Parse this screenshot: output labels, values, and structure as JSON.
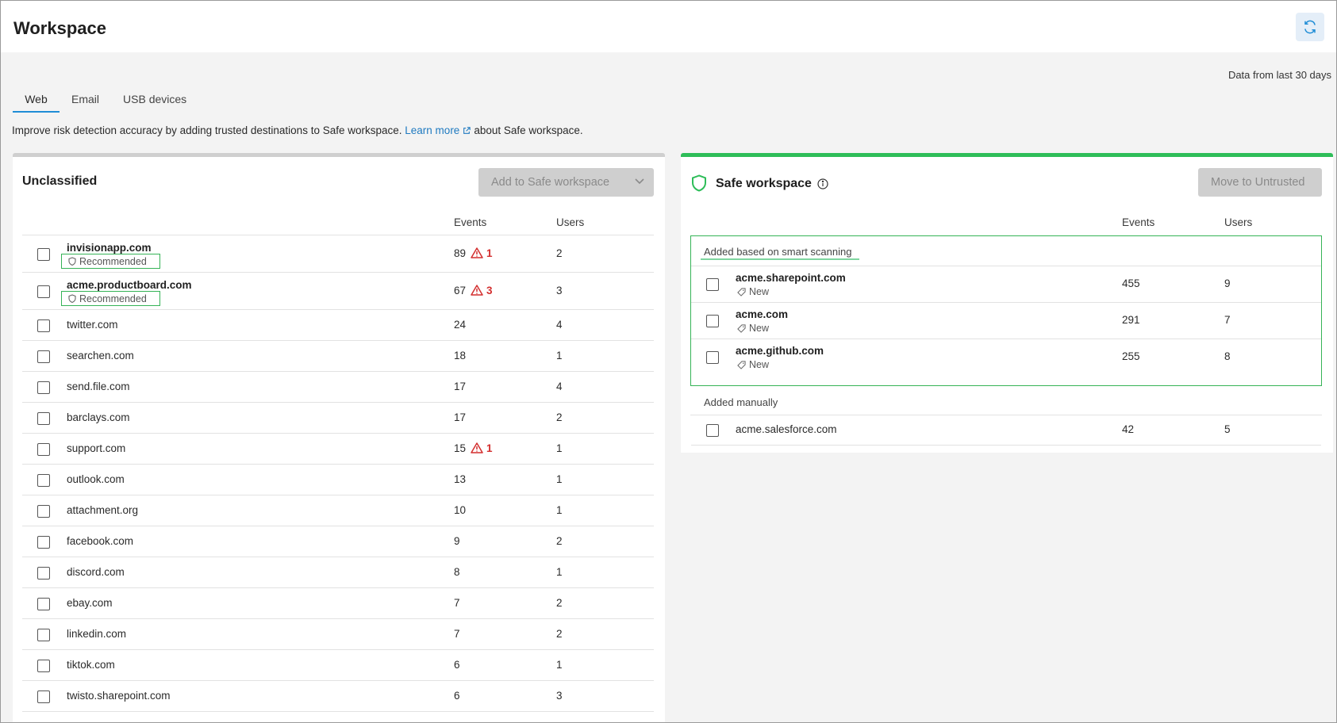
{
  "header": {
    "title": "Workspace"
  },
  "data_range": "Data from last 30 days",
  "tabs": [
    {
      "label": "Web",
      "active": true
    },
    {
      "label": "Email",
      "active": false
    },
    {
      "label": "USB devices",
      "active": false
    }
  ],
  "intro": {
    "before": "Improve risk detection accuracy by adding trusted destinations to Safe workspace.",
    "link": "Learn more",
    "after": "about Safe workspace."
  },
  "unclassified": {
    "title": "Unclassified",
    "button": "Add to Safe workspace",
    "columns": {
      "events": "Events",
      "users": "Users"
    },
    "recommended_label": "Recommended",
    "rows": [
      {
        "domain": "invisionapp.com",
        "events": "89",
        "alerts": "1",
        "users": "2",
        "recommended": true
      },
      {
        "domain": "acme.productboard.com",
        "events": "67",
        "alerts": "3",
        "users": "3",
        "recommended": true
      },
      {
        "domain": "twitter.com",
        "events": "24",
        "alerts": "",
        "users": "4"
      },
      {
        "domain": "searchen.com",
        "events": "18",
        "alerts": "",
        "users": "1"
      },
      {
        "domain": "send.file.com",
        "events": "17",
        "alerts": "",
        "users": "4"
      },
      {
        "domain": "barclays.com",
        "events": "17",
        "alerts": "",
        "users": "2"
      },
      {
        "domain": "support.com",
        "events": "15",
        "alerts": "1",
        "users": "1"
      },
      {
        "domain": "outlook.com",
        "events": "13",
        "alerts": "",
        "users": "1"
      },
      {
        "domain": "attachment.org",
        "events": "10",
        "alerts": "",
        "users": "1"
      },
      {
        "domain": "facebook.com",
        "events": "9",
        "alerts": "",
        "users": "2"
      },
      {
        "domain": "discord.com",
        "events": "8",
        "alerts": "",
        "users": "1"
      },
      {
        "domain": "ebay.com",
        "events": "7",
        "alerts": "",
        "users": "2"
      },
      {
        "domain": "linkedin.com",
        "events": "7",
        "alerts": "",
        "users": "2"
      },
      {
        "domain": "tiktok.com",
        "events": "6",
        "alerts": "",
        "users": "1"
      },
      {
        "domain": "twisto.sharepoint.com",
        "events": "6",
        "alerts": "",
        "users": "3"
      }
    ]
  },
  "safe": {
    "title": "Safe workspace",
    "button": "Move to Untrusted",
    "columns": {
      "events": "Events",
      "users": "Users"
    },
    "smart_label": "Added based on smart scanning",
    "new_label": "New",
    "smart_rows": [
      {
        "domain": "acme.sharepoint.com",
        "events": "455",
        "users": "9"
      },
      {
        "domain": "acme.com",
        "events": "291",
        "users": "7"
      },
      {
        "domain": "acme.github.com",
        "events": "255",
        "users": "8"
      }
    ],
    "manual_label": "Added manually",
    "manual_rows": [
      {
        "domain": "acme.salesforce.com",
        "events": "42",
        "users": "5"
      }
    ]
  },
  "colors": {
    "accent": "#1f8dd6",
    "safe_green": "#2ebd59",
    "alert_red": "#d32f2f"
  },
  "icons": [
    "refresh-icon",
    "external-link-icon",
    "chevron-down-icon",
    "warning-icon",
    "shield-icon",
    "info-icon",
    "tag-icon"
  ]
}
